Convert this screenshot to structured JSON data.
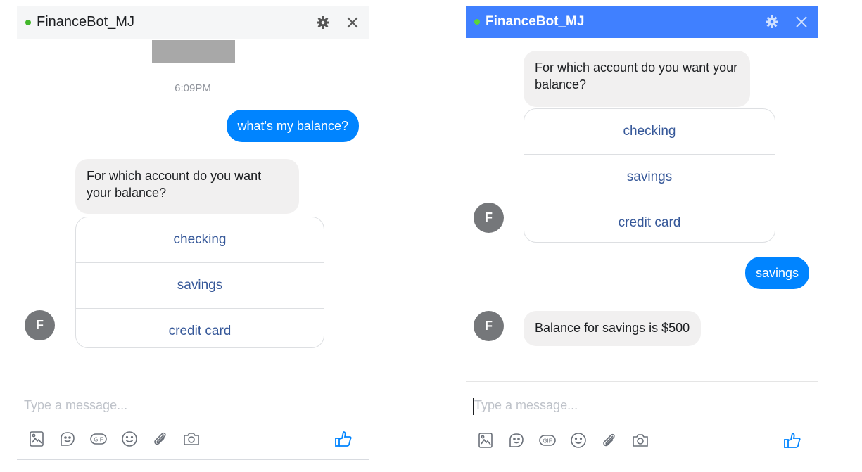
{
  "colors": {
    "accent": "#0084ff",
    "header_active": "#4080ff",
    "online": "#42b72a",
    "link": "#365899",
    "incoming_bubble": "#f1f0f0",
    "avatar": "#75777a"
  },
  "panel1": {
    "header": {
      "title": "FinanceBot_MJ",
      "icons": [
        "gear-icon",
        "close-icon"
      ]
    },
    "timestamp": "6:09PM",
    "user_message": "what's my balance?",
    "bot_message": "For which account do you want your balance?",
    "quick_replies": [
      "checking",
      "savings",
      "credit card"
    ],
    "avatar_letter": "F",
    "composer": {
      "placeholder": "Type a message...",
      "tools": [
        "photo-icon",
        "sticker-icon",
        "gif-icon",
        "emoji-icon",
        "attachment-icon",
        "camera-icon"
      ],
      "like": "thumbs-up-icon"
    }
  },
  "panel2": {
    "header": {
      "title": "FinanceBot_MJ",
      "icons": [
        "gear-icon",
        "close-icon"
      ]
    },
    "bot_message": "For which account do you want your balance?",
    "quick_replies": [
      "checking",
      "savings",
      "credit card"
    ],
    "avatar_letter": "F",
    "user_message": "savings",
    "bot_reply": "Balance for savings is $500",
    "composer": {
      "placeholder": "Type a message...",
      "tools": [
        "photo-icon",
        "sticker-icon",
        "gif-icon",
        "emoji-icon",
        "attachment-icon",
        "camera-icon"
      ],
      "like": "thumbs-up-icon"
    }
  }
}
